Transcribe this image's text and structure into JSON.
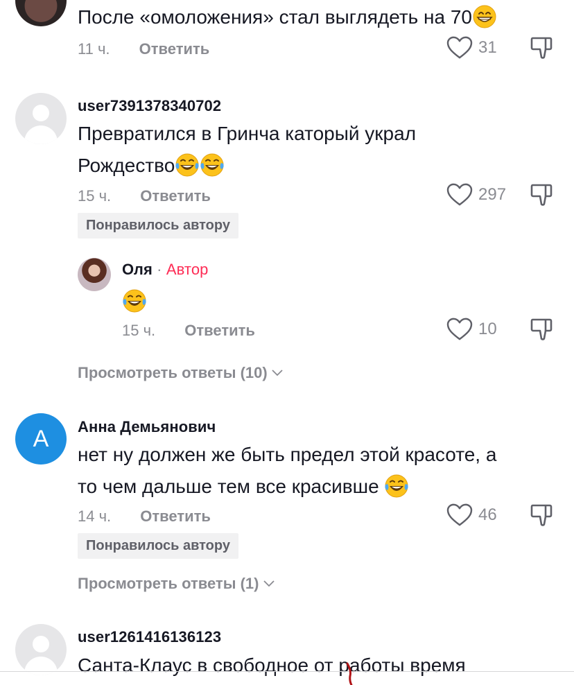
{
  "comments": [
    {
      "text": "После «омоложения» стал выглядеть на 70",
      "time": "11 ч.",
      "reply": "Ответить",
      "likes": "31"
    },
    {
      "username": "user7391378340702",
      "text_line1": "Превратился в Гринча каторый украл",
      "text_line2": "Рождество",
      "time": "15 ч.",
      "reply": "Ответить",
      "likes": "297",
      "badge": "Понравилось автору"
    },
    {
      "username": "Оля",
      "dot": "·",
      "author_tag": "Автор",
      "time": "15 ч.",
      "reply": "Ответить",
      "likes": "10"
    },
    {
      "view_replies": "Просмотреть ответы (10)"
    },
    {
      "avatar_letter": "А",
      "username": "Анна Демьянович",
      "text_line1": "нет ну должен же быть предел этой красоте, а",
      "text_line2": "то чем дальше тем все красивше",
      "time": "14 ч.",
      "reply": "Ответить",
      "likes": "46",
      "badge": "Понравилось автору",
      "view_replies": "Просмотреть ответы (1)"
    },
    {
      "username": "user1261416136123",
      "text": "Санта-Клаус в свободное от работы время"
    }
  ],
  "icons": [
    "heart-icon",
    "dislike-icon",
    "chevron-down-icon",
    "laughing-emoji",
    "grinning-emoji"
  ],
  "colors": {
    "author_tag": "#fe2c55",
    "avatar_letter_bg": "#1e8fe1",
    "muted": "#8a8b91"
  }
}
